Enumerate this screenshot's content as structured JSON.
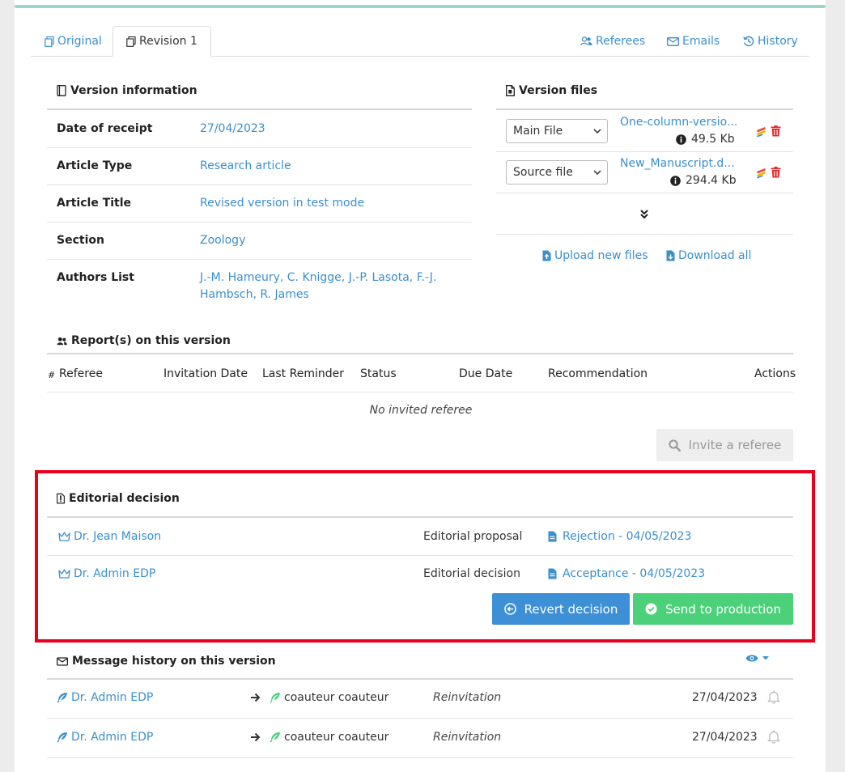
{
  "tabs": {
    "original": "Original",
    "revision": "Revision 1",
    "referees": "Referees",
    "emails": "Emails",
    "history": "History"
  },
  "version_info": {
    "title": "Version information",
    "rows": [
      {
        "label": "Date of receipt",
        "value": "27/04/2023"
      },
      {
        "label": "Article Type",
        "value": "Research article"
      },
      {
        "label": "Article Title",
        "value": "Revised version in test mode"
      },
      {
        "label": "Section",
        "value": "Zoology"
      },
      {
        "label": "Authors List",
        "value_line1": "J.-M. Hameury, C. Knigge, J.-P. Lasota, F.-J.",
        "value_line2": "Hambsch, R. James"
      }
    ]
  },
  "version_files": {
    "title": "Version files",
    "files": [
      {
        "type": "Main File",
        "name": "One-column-versio...",
        "size": "49.5 Kb"
      },
      {
        "type": "Source file",
        "name": "New_Manuscript.d...",
        "size": "294.4 Kb"
      }
    ],
    "upload_label": "Upload new files",
    "download_label": "Download all"
  },
  "reports": {
    "title": "Report(s) on this version",
    "columns": {
      "num": "#",
      "referee": "Referee",
      "invitation_date": "Invitation Date",
      "last_reminder": "Last Reminder",
      "status": "Status",
      "due_date": "Due Date",
      "recommendation": "Recommendation",
      "actions": "Actions"
    },
    "empty": "No invited referee",
    "invite_label": "Invite a referee"
  },
  "editorial": {
    "title": "Editorial decision",
    "rows": [
      {
        "person": "Dr. Jean Maison",
        "kind": "Editorial proposal",
        "decision": "Rejection - 04/05/2023"
      },
      {
        "person": "Dr. Admin EDP",
        "kind": "Editorial decision",
        "decision": "Acceptance - 04/05/2023"
      }
    ],
    "revert_label": "Revert decision",
    "send_label": "Send to production"
  },
  "messages": {
    "title": "Message history on this version",
    "rows": [
      {
        "from": "Dr. Admin EDP",
        "to": "coauteur coauteur",
        "subject": "Reinvitation",
        "date": "27/04/2023"
      },
      {
        "from": "Dr. Admin EDP",
        "to": "coauteur coauteur",
        "subject": "Reinvitation",
        "date": "27/04/2023"
      }
    ]
  },
  "colors": {
    "link": "#3a8fcd",
    "highlight": "#e8001c",
    "accent_bar": "#9ad8cc",
    "primary_button": "#3d8fd6",
    "success_button": "#4cd07a",
    "danger_icon": "#e02b2b"
  }
}
